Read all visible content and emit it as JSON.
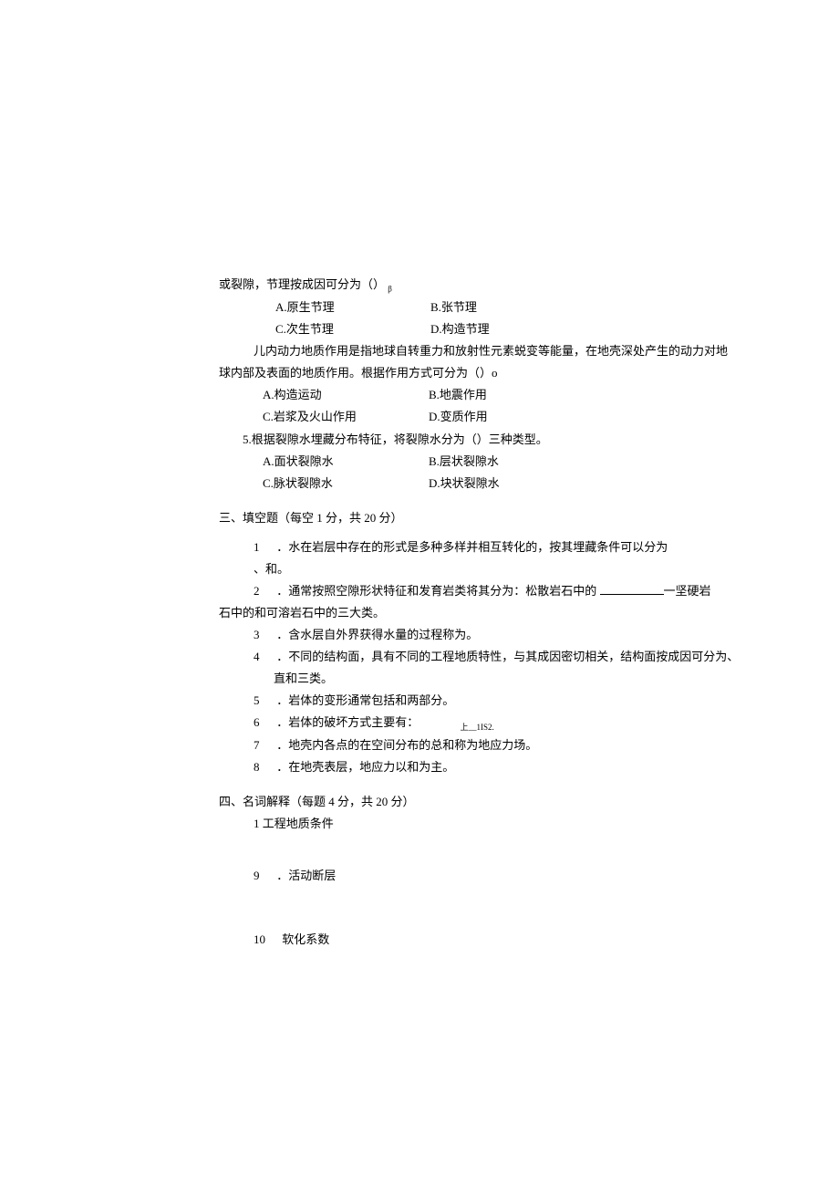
{
  "q3_stem_part": "或裂隙，节理按成因可分为（）",
  "q3_sub": "β",
  "q3_A": "A.原生节理",
  "q3_B": "B.张节理",
  "q3_C": "C.次生节理",
  "q3_D": "D.构造节理",
  "q4_stem_a": "儿内动力地质作用是指地球自转重力和放射性元素蜕变等能量，在地壳深处产生的动力对地",
  "q4_stem_b": "球内部及表面的地质作用。根据作用方式可分为（）o",
  "q4_A": "A.构造运动",
  "q4_B": "B.地震作用",
  "q4_C": "C.岩浆及火山作用",
  "q4_D": "D.变质作用",
  "q5_stem": "5.根据裂隙水埋藏分布特征，将裂隙水分为（）三种类型。",
  "q5_A": "A.面状裂隙水",
  "q5_B": "B.层状裂隙水",
  "q5_C": "C.脉状裂隙水",
  "q5_D": "D.块状裂隙水",
  "sec3_title": "三、填空题（每空 1 分，共 20 分）",
  "f1_num": "1",
  "f1_text": "．水在岩层中存在的形式是多种多样并相互转化的，按其埋藏条件可以分为",
  "f1b": "、和。",
  "f2_num": "2",
  "f2_text_a": "．通常按照空隙形状特征和发育岩类将其分为：松散岩石中的 ",
  "f2_text_b": "一坚硬岩",
  "f2b": "石中的和可溶岩石中的三大类。",
  "f3_num": "3",
  "f3_text": "．含水层自外界获得水量的过程称为。",
  "f4_num": "4",
  "f4_text_a": "．不同的结构面，具有不同的工程地质特性，与其成因密切相关，结构面按成因可分为、",
  "f4_text_b": "直和三类。",
  "f5_num": "5",
  "f5_text": "．岩体的变形通常包括和两部分。",
  "f6_num": "6",
  "f6_text": "．岩体的破坏方式主要有：",
  "f6_small": "上__1IS2.",
  "f7_num": "7",
  "f7_text": "．地壳内各点的在空间分布的总和称为地应力场。",
  "f8_num": "8",
  "f8_text": "．在地壳表层，地应力以和为主。",
  "sec4_title": "四、名词解释（每题 4 分，共 20 分）",
  "t1": "1 工程地质条件",
  "t9_num": "9",
  "t9_text": "．活动断层",
  "t10_num": "10",
  "t10_text": "软化系数"
}
